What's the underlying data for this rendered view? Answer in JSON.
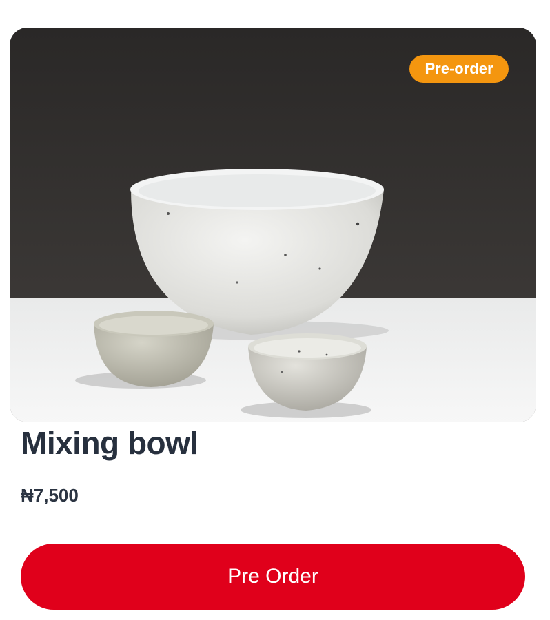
{
  "product": {
    "title": "Mixing bowl",
    "price": "₦7,500",
    "badge": "Pre-order",
    "image_icon": "bowl-photo"
  },
  "actions": {
    "preorder_label": "Pre Order"
  },
  "colors": {
    "badge_bg": "#f4960f",
    "cta_bg": "#e0001b",
    "title_text": "#27303e"
  }
}
